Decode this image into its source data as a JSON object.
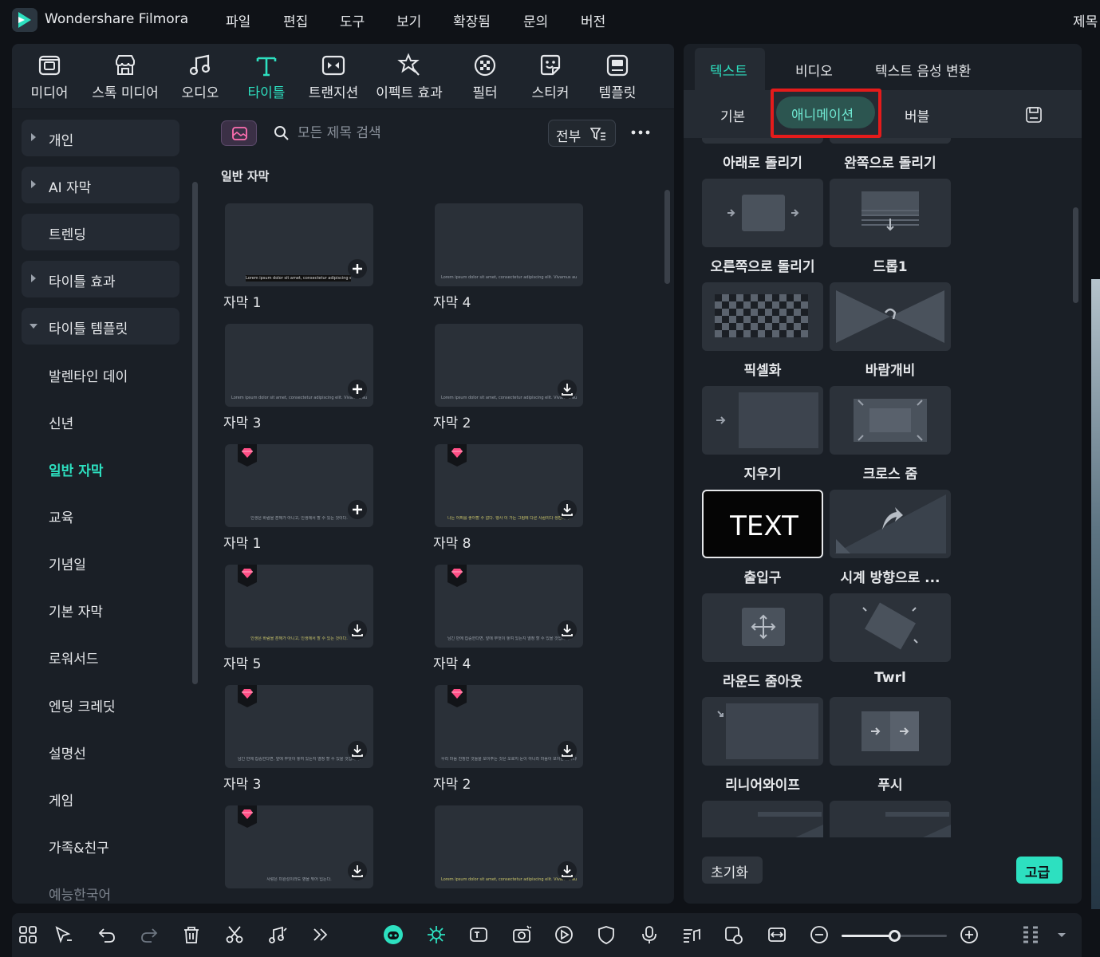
{
  "app": {
    "title": "Wondershare Filmora",
    "title_right": "제목"
  },
  "menu": [
    "파일",
    "편집",
    "도구",
    "보기",
    "확장됨",
    "문의",
    "버전"
  ],
  "media_toolbar": [
    {
      "label": "미디어",
      "icon": "media-icon"
    },
    {
      "label": "스톡 미디어",
      "icon": "stock-media-icon"
    },
    {
      "label": "오디오",
      "icon": "audio-icon"
    },
    {
      "label": "타이틀",
      "icon": "title-icon",
      "active": true
    },
    {
      "label": "트랜지션",
      "icon": "transition-icon"
    },
    {
      "label": "이펙트 효과",
      "icon": "effects-icon"
    },
    {
      "label": "필터",
      "icon": "filter-icon"
    },
    {
      "label": "스티커",
      "icon": "sticker-icon"
    },
    {
      "label": "템플릿",
      "icon": "template-icon"
    }
  ],
  "sidebar": {
    "categories": [
      {
        "label": "개인",
        "arrow": "right"
      },
      {
        "label": "AI 자막",
        "arrow": "right"
      },
      {
        "label": "트렌딩",
        "arrow": "none"
      },
      {
        "label": "타이틀 효과",
        "arrow": "right"
      },
      {
        "label": "타이틀 템플릿",
        "arrow": "down"
      }
    ],
    "subitems": [
      "발렌타인 데이",
      "신년",
      "일반 자막",
      "교육",
      "기념일",
      "기본 자막",
      "로워서드",
      "엔딩 크레딧",
      "설명선",
      "게임",
      "가족&친구",
      "예능한국어"
    ],
    "active_subitem": "일반 자막"
  },
  "search": {
    "placeholder": "모든 제목 검색",
    "filter_label": "전부"
  },
  "section_title": "일반 자막",
  "cards": [
    {
      "label": "자막 1",
      "caption": "Lorem ipsum dolor sit amet, consectetur adipiscing elit. Vivamus auctor id justo eu ultrices.",
      "style": "dark",
      "action": "add",
      "premium": false
    },
    {
      "label": "자막 4",
      "caption": "Lorem ipsum dolor sit amet, consectetur adipiscing elit. Vivamus auctor id justo eu ultrices.",
      "style": "plain",
      "action": "none",
      "premium": false
    },
    {
      "label": "자막 3",
      "caption": "Lorem ipsum dolor sit amet, consectetur adipiscing elit. Vivamus auctor id justo eu ultrices.",
      "style": "plain",
      "action": "add",
      "premium": false
    },
    {
      "label": "자막 2",
      "caption": "Lorem ipsum dolor sit amet, consectetur adipiscing elit. Vivamus auctor id justo eu ultrices.",
      "style": "plain",
      "action": "download",
      "premium": false
    },
    {
      "label": "자막 1",
      "caption": "인생은 바람을 훈해가 아니고, 인생에서 할 수 있는 것이다.",
      "style": "plain",
      "action": "add",
      "premium": true
    },
    {
      "label": "자막 8",
      "caption": "나는 어쩌를 좋아할 수 없다. 행사 이 가든 그림에 다른 사람이다 생판이다.",
      "style": "yellow",
      "action": "download",
      "premium": true
    },
    {
      "label": "자막 5",
      "caption": "인생은 바람을 훈해가 아니고, 인생에서 할 수 있는 것이다.",
      "style": "yellow",
      "action": "download",
      "premium": true
    },
    {
      "label": "자막 4",
      "caption": "남긴 만에 집중한다면, 앞에 무엇이 놓여 있든지 열정 할 수 있을 것입니다.",
      "style": "plain",
      "action": "download",
      "premium": true
    },
    {
      "label": "자막 3",
      "caption": "남긴 만에 집중한다면, 앞에 무엇이 놓여 있든지 열정 할 수 있을 것입니다.",
      "style": "plain",
      "action": "download",
      "premium": true
    },
    {
      "label": "자막 2",
      "caption": "우리 마음 진정한 것들을 보이주는 것은 오로지 눈이 아니라 마음이 보이는 것이니다.",
      "style": "plain",
      "action": "download",
      "premium": true
    },
    {
      "label": "",
      "caption": "사랑은 미완성이라도 영을 뛰어 입는다.",
      "style": "plain",
      "action": "download",
      "premium": true
    },
    {
      "label": "",
      "caption": "Lorem ipsum dolor sit amet, consectetur adipiscing elit. Vivamus auctor id justo eu ultrices.",
      "style": "yellow",
      "action": "download",
      "premium": false
    }
  ],
  "right_panel": {
    "top_tabs": [
      "텍스트",
      "비디오",
      "텍스트 음성 변환"
    ],
    "active_top_tab": "텍스트",
    "sub_tabs": [
      "기본",
      "애니메이션",
      "버블"
    ],
    "active_sub_tab": "애니메이션",
    "animations": [
      {
        "label": "아래로 돌리기",
        "thumb": "partial"
      },
      {
        "label": "완쪽으로 돌리기",
        "thumb": "partial"
      },
      {
        "label": "오른쪽으로 돌리기",
        "thumb": "slide-right"
      },
      {
        "label": "드롭1",
        "thumb": "drop"
      },
      {
        "label": "픽셀화",
        "thumb": "pixelate"
      },
      {
        "label": "바람개비",
        "thumb": "pinwheel"
      },
      {
        "label": "지우기",
        "thumb": "wipe"
      },
      {
        "label": "크로스 줌",
        "thumb": "cross-zoom"
      },
      {
        "label": "출입구",
        "thumb": "text",
        "thumb_text": "TEXT",
        "selected": true
      },
      {
        "label": "시계 방향으로 ...",
        "thumb": "clockwise"
      },
      {
        "label": "라운드 줌아웃",
        "thumb": "round-zoom"
      },
      {
        "label": "Twrl",
        "thumb": "twirl"
      },
      {
        "label": "리니어와이프",
        "thumb": "linear-wipe"
      },
      {
        "label": "푸시",
        "thumb": "push"
      },
      {
        "label": "",
        "thumb": "partial-b"
      },
      {
        "label": "",
        "thumb": "partial-b"
      }
    ],
    "reset_label": "초기화",
    "advanced_label": "고급"
  },
  "timeline_toolbar": {
    "icons": [
      "layout-icon",
      "select-tool-icon",
      "undo-icon",
      "redo-icon",
      "delete-icon",
      "scissors-icon",
      "audio-note-icon",
      "more-chevrons-icon",
      "ai-assistant-icon",
      "auto-highlight-icon",
      "text-to-speech-icon",
      "record-screen-icon",
      "play-render-icon",
      "shield-icon",
      "microphone-icon",
      "audio-mix-icon",
      "replace-icon",
      "fit-icon",
      "zoom-out-icon",
      "zoom-in-icon",
      "grid-options-icon",
      "dropdown-icon"
    ],
    "zoom_level": 0.5
  },
  "colors": {
    "accent": "#2de0c0",
    "highlight": "#e51b1b",
    "panel": "#1a1f26",
    "gem": "#ff4f86"
  }
}
